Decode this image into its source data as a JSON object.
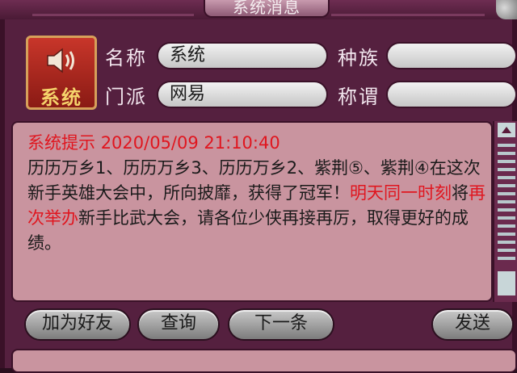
{
  "window": {
    "title": "系统消息"
  },
  "sender": {
    "avatar_label": "系统",
    "name_label": "名称",
    "name_value": "系统",
    "race_label": "种族",
    "race_value": "",
    "sect_label": "门派",
    "sect_value": "网易",
    "title_label": "称谓",
    "title_value": ""
  },
  "message": {
    "header": "系统提示",
    "timestamp": "2020/05/09 21:10:40",
    "part1": "历历万乡1、历历万乡3、历历万乡2、紫荆⑤、紫荆④在这次新手英雄大会中，所向披靡，获得了冠军！",
    "highlight1": "明天同一时刻",
    "part2": "将",
    "highlight2": "再次举办",
    "part3": "新手比武大会，请各位少侠再接再厉，取得更好的成绩。"
  },
  "buttons": {
    "add_friend": "加为好友",
    "query": "查询",
    "next": "下一条",
    "send": "发送"
  },
  "colors": {
    "highlight": "#e0161f",
    "panel": "#55203f",
    "message_bg": "#c9949f"
  }
}
